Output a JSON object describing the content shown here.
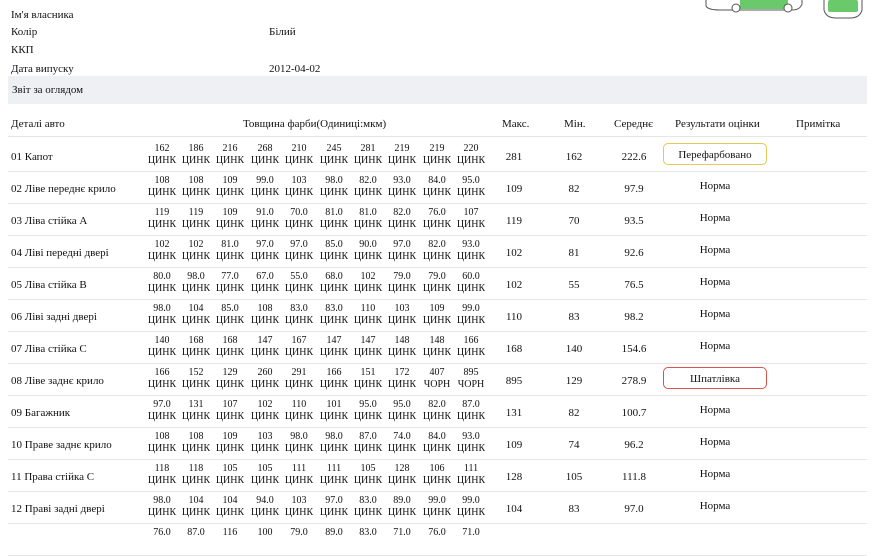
{
  "info": {
    "owner_label": "Ім'я власника",
    "color_label": "Колір",
    "color_value": "Білий",
    "gearbox_label": "ККП",
    "gearbox_value": "",
    "release_label": "Дата випуску",
    "release_value": "2012-04-02"
  },
  "section_title": "Звіт за оглядом",
  "table_headers": {
    "part": "Деталі авто",
    "thickness": "Товщина фарби(Одиниці:мкм)",
    "max": "Макс.",
    "min": "Мін.",
    "avg": "Середнє",
    "result": "Результати оцінки",
    "note": "Примітка"
  },
  "colors": {
    "repaint_border": "#e3c85a",
    "putty_border": "#d9534f",
    "header_bg": "#eef0f3",
    "car_green": "#6ac96a"
  },
  "rows": [
    {
      "name": "01 Капот",
      "values": [
        "162",
        "186",
        "216",
        "268",
        "210",
        "245",
        "281",
        "219",
        "219",
        "220"
      ],
      "materials": [
        "ЦИНК",
        "ЦИНК",
        "ЦИНК",
        "ЦИНК",
        "ЦИНК",
        "ЦИНК",
        "ЦИНК",
        "ЦИНК",
        "ЦИНК",
        "ЦИНК"
      ],
      "max": "281",
      "min": "162",
      "avg": "222.6",
      "result": "Перефарбовано",
      "result_type": "repaint"
    },
    {
      "name": "02 Ліве переднє крило",
      "values": [
        "108",
        "108",
        "109",
        "99.0",
        "103",
        "98.0",
        "82.0",
        "93.0",
        "84.0",
        "95.0"
      ],
      "materials": [
        "ЦИНК",
        "ЦИНК",
        "ЦИНК",
        "ЦИНК",
        "ЦИНК",
        "ЦИНК",
        "ЦИНК",
        "ЦИНК",
        "ЦИНК",
        "ЦИНК"
      ],
      "max": "109",
      "min": "82",
      "avg": "97.9",
      "result": "Норма",
      "result_type": "normal"
    },
    {
      "name": "03 Ліва стійка А",
      "values": [
        "119",
        "119",
        "109",
        "91.0",
        "70.0",
        "81.0",
        "81.0",
        "82.0",
        "76.0",
        "107"
      ],
      "materials": [
        "ЦИНК",
        "ЦИНК",
        "ЦИНК",
        "ЦИНК",
        "ЦИНК",
        "ЦИНК",
        "ЦИНК",
        "ЦИНК",
        "ЦИНК",
        "ЦИНК"
      ],
      "max": "119",
      "min": "70",
      "avg": "93.5",
      "result": "Норма",
      "result_type": "normal"
    },
    {
      "name": "04 Ліві передні двері",
      "values": [
        "102",
        "102",
        "81.0",
        "97.0",
        "97.0",
        "85.0",
        "90.0",
        "97.0",
        "82.0",
        "93.0"
      ],
      "materials": [
        "ЦИНК",
        "ЦИНК",
        "ЦИНК",
        "ЦИНК",
        "ЦИНК",
        "ЦИНК",
        "ЦИНК",
        "ЦИНК",
        "ЦИНК",
        "ЦИНК"
      ],
      "max": "102",
      "min": "81",
      "avg": "92.6",
      "result": "Норма",
      "result_type": "normal"
    },
    {
      "name": "05 Ліва стійка В",
      "values": [
        "80.0",
        "98.0",
        "77.0",
        "67.0",
        "55.0",
        "68.0",
        "102",
        "79.0",
        "79.0",
        "60.0"
      ],
      "materials": [
        "ЦИНК",
        "ЦИНК",
        "ЦИНК",
        "ЦИНК",
        "ЦИНК",
        "ЦИНК",
        "ЦИНК",
        "ЦИНК",
        "ЦИНК",
        "ЦИНК"
      ],
      "max": "102",
      "min": "55",
      "avg": "76.5",
      "result": "Норма",
      "result_type": "normal"
    },
    {
      "name": "06 Ліві задні двері",
      "values": [
        "98.0",
        "104",
        "85.0",
        "108",
        "83.0",
        "83.0",
        "110",
        "103",
        "109",
        "99.0"
      ],
      "materials": [
        "ЦИНК",
        "ЦИНК",
        "ЦИНК",
        "ЦИНК",
        "ЦИНК",
        "ЦИНК",
        "ЦИНК",
        "ЦИНК",
        "ЦИНК",
        "ЦИНК"
      ],
      "max": "110",
      "min": "83",
      "avg": "98.2",
      "result": "Норма",
      "result_type": "normal"
    },
    {
      "name": "07 Ліва стійка С",
      "values": [
        "140",
        "168",
        "168",
        "147",
        "167",
        "147",
        "147",
        "148",
        "148",
        "166"
      ],
      "materials": [
        "ЦИНК",
        "ЦИНК",
        "ЦИНК",
        "ЦИНК",
        "ЦИНК",
        "ЦИНК",
        "ЦИНК",
        "ЦИНК",
        "ЦИНК",
        "ЦИНК"
      ],
      "max": "168",
      "min": "140",
      "avg": "154.6",
      "result": "Норма",
      "result_type": "normal"
    },
    {
      "name": "08 Ліве заднє крило",
      "values": [
        "166",
        "152",
        "129",
        "260",
        "291",
        "166",
        "151",
        "172",
        "407",
        "895"
      ],
      "materials": [
        "ЦИНК",
        "ЦИНК",
        "ЦИНК",
        "ЦИНК",
        "ЦИНК",
        "ЦИНК",
        "ЦИНК",
        "ЦИНК",
        "ЧОРН",
        "ЧОРН"
      ],
      "max": "895",
      "min": "129",
      "avg": "278.9",
      "result": "Шпатлівка",
      "result_type": "putty"
    },
    {
      "name": "09 Багажник",
      "values": [
        "97.0",
        "131",
        "107",
        "102",
        "110",
        "101",
        "95.0",
        "95.0",
        "82.0",
        "87.0"
      ],
      "materials": [
        "ЦИНК",
        "ЦИНК",
        "ЦИНК",
        "ЦИНК",
        "ЦИНК",
        "ЦИНК",
        "ЦИНК",
        "ЦИНК",
        "ЦИНК",
        "ЦИНК"
      ],
      "max": "131",
      "min": "82",
      "avg": "100.7",
      "result": "Норма",
      "result_type": "normal"
    },
    {
      "name": "10 Праве заднє крило",
      "values": [
        "108",
        "108",
        "109",
        "103",
        "98.0",
        "98.0",
        "87.0",
        "74.0",
        "84.0",
        "93.0"
      ],
      "materials": [
        "ЦИНК",
        "ЦИНК",
        "ЦИНК",
        "ЦИНК",
        "ЦИНК",
        "ЦИНК",
        "ЦИНК",
        "ЦИНК",
        "ЦИНК",
        "ЦИНК"
      ],
      "max": "109",
      "min": "74",
      "avg": "96.2",
      "result": "Норма",
      "result_type": "normal"
    },
    {
      "name": "11 Права стійка С",
      "values": [
        "118",
        "118",
        "105",
        "105",
        "111",
        "111",
        "105",
        "128",
        "106",
        "111"
      ],
      "materials": [
        "ЦИНК",
        "ЦИНК",
        "ЦИНК",
        "ЦИНК",
        "ЦИНК",
        "ЦИНК",
        "ЦИНК",
        "ЦИНК",
        "ЦИНК",
        "ЦИНК"
      ],
      "max": "128",
      "min": "105",
      "avg": "111.8",
      "result": "Норма",
      "result_type": "normal"
    },
    {
      "name": "12 Праві задні двері",
      "values": [
        "98.0",
        "104",
        "104",
        "94.0",
        "103",
        "97.0",
        "83.0",
        "89.0",
        "99.0",
        "99.0"
      ],
      "materials": [
        "ЦИНК",
        "ЦИНК",
        "ЦИНК",
        "ЦИНК",
        "ЦИНК",
        "ЦИНК",
        "ЦИНК",
        "ЦИНК",
        "ЦИНК",
        "ЦИНК"
      ],
      "max": "104",
      "min": "83",
      "avg": "97.0",
      "result": "Норма",
      "result_type": "normal"
    },
    {
      "name": "",
      "values": [
        "76.0",
        "87.0",
        "116",
        "100",
        "79.0",
        "89.0",
        "83.0",
        "71.0",
        "76.0",
        "71.0"
      ],
      "materials": [
        "",
        "",
        "",
        "",
        "",
        "",
        "",
        "",
        "",
        ""
      ],
      "max": "",
      "min": "",
      "avg": "",
      "result": "",
      "result_type": "none"
    }
  ]
}
